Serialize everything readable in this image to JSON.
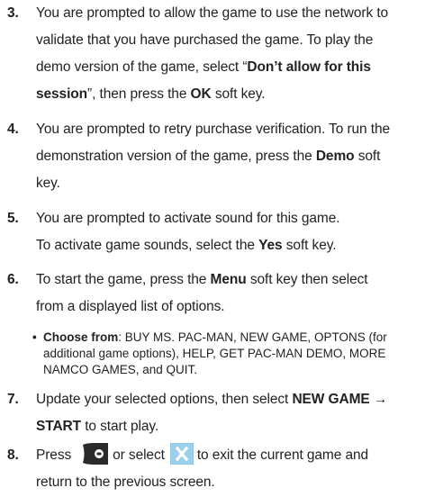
{
  "steps": [
    {
      "number": "3.",
      "l1": "You are prompted to allow the game to use the network to",
      "l2": "validate that you have purchased the game. To play the",
      "l3_pre": "demo version of the game, select “",
      "l3_bold": "Don’t allow for this",
      "l4_bold": "session",
      "l4_mid": "”, then press the ",
      "l4_bold2": "OK",
      "l4_post": " soft key."
    },
    {
      "number": "4.",
      "l1": "You are prompted to retry purchase verification. To run the",
      "l2_pre": "demonstration version of the game, press the ",
      "l2_bold": "Demo",
      "l2_post": " soft",
      "l3": "key."
    },
    {
      "number": "5.",
      "l1": "You are prompted to activate sound for this game.",
      "l2_pre": "To activate game sounds, select the ",
      "l2_bold": "Yes",
      "l2_post": " soft key."
    },
    {
      "number": "6.",
      "l1_pre": "To start the game, press the ",
      "l1_bold": "Menu",
      "l1_post": " soft key then select",
      "l2": "from a displayed list of options.",
      "bullet_symbol": "•",
      "bullet_label": "Choose from",
      "bullet_l1": ": BUY MS. PAC-MAN, NEW GAME, OPTONS (for",
      "bullet_l2": "additional game options), HELP, GET PAC-MAN DEMO, MORE",
      "bullet_l3": "NAMCO GAMES, and QUIT."
    },
    {
      "number": "7.",
      "l1_pre": "Update your selected options, then select ",
      "l1_bold": "NEW GAME →",
      "l2_bold": "START",
      "l2_post": " to start play."
    },
    {
      "number": "8.",
      "l1_a": "Press",
      "l1_b": "or select",
      "l1_c": "to exit the current game and",
      "l2": "return to the previous screen."
    }
  ],
  "icons": {
    "end_key": "end-key-icon",
    "close_button": "close-x-icon",
    "close_color": "#86c8e8"
  }
}
